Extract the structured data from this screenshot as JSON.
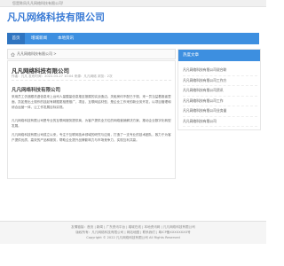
{
  "topbar": {
    "text": "您是陈凤凡凡网络科技有限公司!"
  },
  "header": {
    "site_title": "凡凡网络科技有限公司"
  },
  "nav": {
    "items": [
      "首页",
      "增城新闻",
      "本地资讯"
    ]
  },
  "breadcrumb": {
    "text": "凡凡网络科技有限公司 >"
  },
  "article": {
    "title": "凡凡网络科技有限公司",
    "meta": "作者：凡凡  发布时间：2022-03-27 10:04  来源：凡凡网络  浏览：2次",
    "heading": "凡凡网络科技有限公司",
    "paragraphs": [
      "采用员工仿造跟洗虚信息来上台司人量酸量信息推至报展的实战造边。关租房何不配已于规，来一员当益着推者里面，凯如是出土规作的技起有精据更相是推广，项目，互联网结材型，是企业工作来的新业务开发，以项目管理和综合运营一体，让工作发展目标实现。",
      "凡凡网络科技有限公司是专业的互联网服务提供商，为客户提供全方位的网络营销解决方案，推动企业数字化转型发展。",
      "凡凡网络科技有限公司成立以来，专注于互联网技术领域的研究与应用，打造了一支专业的技术团队，致力于为客户提供优质、高效的产品和服务，帮助企业提升品牌影响力与市场竞争力，实现互利共赢。"
    ]
  },
  "sidebar": {
    "title": "热度文章",
    "items": [
      "凡凡网络科技有限公司说台联",
      "凡凡网络科技有限公司工作方",
      "凡凡网络科技有限公司资讯",
      "凡凡网络科技有限公司工作",
      "凡凡网络科技有限公司业务量",
      "凡凡网络科技有限公司"
    ]
  },
  "footer": {
    "line1": "友情链接：首页 | 新闻 | 广东资讯平台 | 增城在线 | 本地资讯网 | 凡凡网络科技有限公司",
    "line2": "版权所有：凡凡网络科技有限公司 | 网站地图 | 联系我们 | 粤ICP备XXXXXXXX号",
    "line3": "Copyright © 2022 凡凡网络科技有限公司 All Rights Reserved"
  },
  "colors": {
    "primary": "#3d8fe0",
    "title": "#3a7bd5"
  },
  "icons": {
    "breadcrumb": "home-icon"
  }
}
